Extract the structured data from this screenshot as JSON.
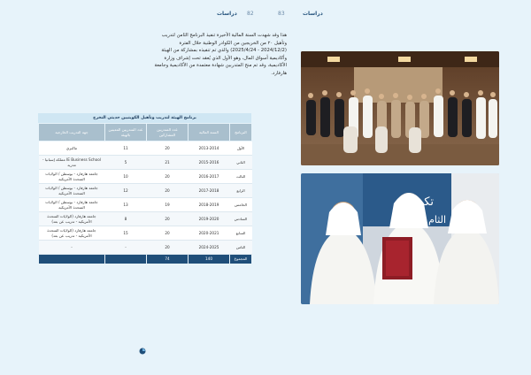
{
  "header": {
    "section": "دراسات",
    "page_right": "83",
    "page_left": "82",
    "section_left": "دراسات"
  },
  "paragraph": "هذا وقد شهدت السنة المالية الأخيرة تنفيذ البرنامج الثامن لتدريب وتأهيل ٢٠ من الخريجين من الكوادر الوطنية خلال الفترة (2024/12/2 - 2025/4/24) والذي تم تنفيذه بمشاركة من الهيئة وأكاديمية أسواق المال، وهو الأول الذي يُعقد تحت إشراف وزارة الأكاديمية، وقد تم منح المتدربين شهادة معتمدة من الأكاديمية وجامعة هارفارد.",
  "table": {
    "title": "برنامج الهيئة لتدريب وتأهيل الكويتيين حديثي التخرج",
    "headers": [
      "البرنامج",
      "السنة المالية",
      "عدد المتدربين المشاركين",
      "عدد المتدربين المعينين بالهيئة",
      "جهة التدريب الخارجية"
    ],
    "rows": [
      [
        "الأول",
        "2013-2014",
        "20",
        "11",
        "ماكنزي"
      ],
      [
        "الثاني",
        "2015-2016",
        "21",
        "5",
        "IE Business School مملكة إسبانيا - مدريد"
      ],
      [
        "الثالث",
        "2016-2017",
        "20",
        "10",
        "جامعة هارفارد - بوسطن / الولايات المتحدة الأمريكية"
      ],
      [
        "الرابع",
        "2017-2018",
        "20",
        "12",
        "جامعة هارفارد - بوسطن / الولايات المتحدة الأمريكية"
      ],
      [
        "الخامس",
        "2018-2019",
        "19",
        "13",
        "جامعة هارفارد - بوسطن / الولايات المتحدة الأمريكية"
      ],
      [
        "السادس",
        "2019-2020",
        "20",
        "8",
        "جامعة هارفارد (الولايات المتحدة الأمريكية - تدريب عن بعد)"
      ],
      [
        "السابع",
        "2020-2021",
        "20",
        "15",
        "جامعة هارفارد (الولايات المتحدة الأمريكية - تدريب عن بعد)"
      ],
      [
        "الثامن",
        "2024-2025",
        "20",
        "-",
        "-"
      ]
    ],
    "total": [
      "المجموع",
      "140",
      "74",
      "",
      ""
    ]
  },
  "photos": [
    {
      "icon": "group-photo"
    },
    {
      "icon": "award-ceremony-photo",
      "sign_text": "تكريم",
      "sign_text2": "الثام"
    }
  ]
}
